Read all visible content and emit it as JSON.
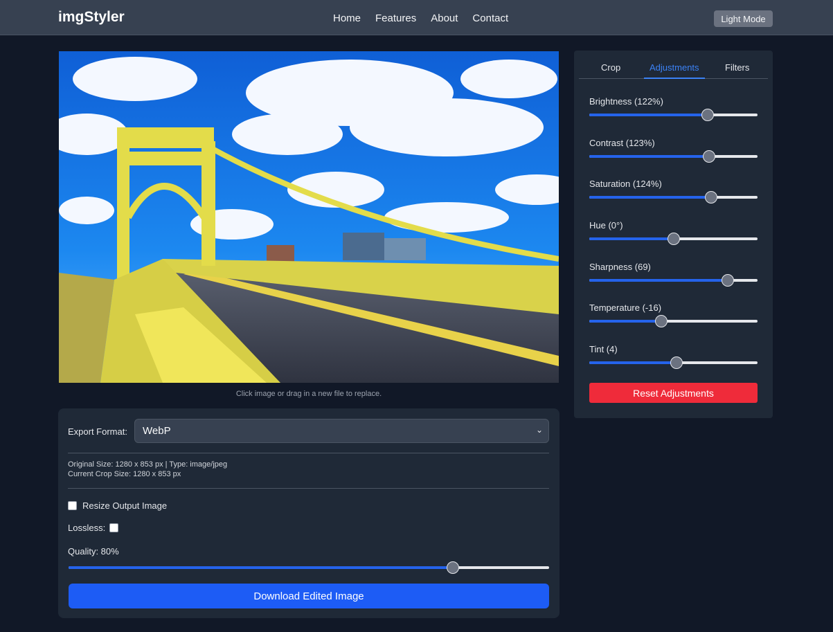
{
  "navbar": {
    "brand": "imgStyler",
    "links": [
      "Home",
      "Features",
      "About",
      "Contact"
    ],
    "mode_button": "Light Mode"
  },
  "image": {
    "hint": "Click image or drag in a new file to replace."
  },
  "export": {
    "format_label": "Export Format:",
    "format_value": "WebP",
    "original_info": "Original Size: 1280 x 853 px | Type: image/jpeg",
    "crop_info": "Current Crop Size: 1280 x 853 px",
    "resize_label": "Resize Output Image",
    "resize_checked": false,
    "lossless_label": "Lossless:",
    "lossless_checked": false,
    "quality_label": "Quality: 80%",
    "quality_value": 0.8,
    "download_label": "Download Edited Image"
  },
  "adjustments_panel": {
    "tabs": [
      "Crop",
      "Adjustments",
      "Filters"
    ],
    "active_tab": "Adjustments",
    "sliders": [
      {
        "label": "Brightness (122%)",
        "fraction": 0.705
      },
      {
        "label": "Contrast (123%)",
        "fraction": 0.713
      },
      {
        "label": "Saturation (124%)",
        "fraction": 0.724
      },
      {
        "label": "Hue (0°)",
        "fraction": 0.5
      },
      {
        "label": "Sharpness (69)",
        "fraction": 0.822
      },
      {
        "label": "Temperature (-16)",
        "fraction": 0.426
      },
      {
        "label": "Tint (4)",
        "fraction": 0.52
      }
    ],
    "reset_label": "Reset Adjustments"
  },
  "colors": {
    "accent": "#2563eb",
    "danger": "#ef2b3a",
    "background": "#111827",
    "panel": "#1f2937"
  }
}
